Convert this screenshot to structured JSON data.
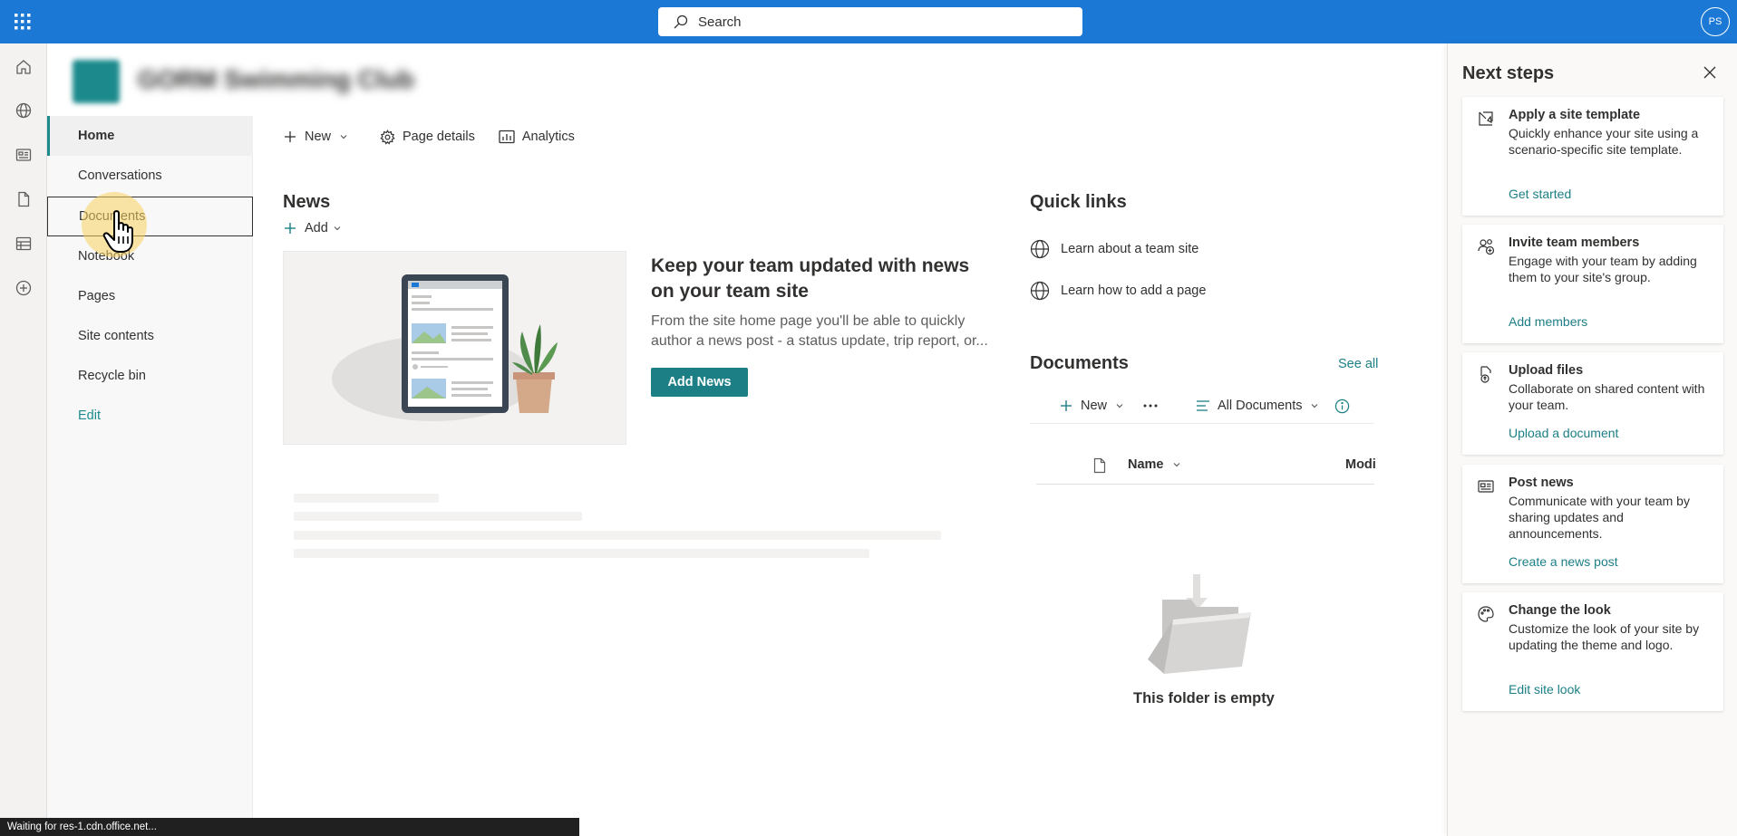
{
  "search": {
    "placeholder": "Search"
  },
  "user": {
    "initials": "PS"
  },
  "site": {
    "title": "GORM Swimming Club"
  },
  "nav": {
    "items": [
      {
        "label": "Home"
      },
      {
        "label": "Conversations"
      },
      {
        "label": "Documents"
      },
      {
        "label": "Notebook"
      },
      {
        "label": "Pages"
      },
      {
        "label": "Site contents"
      },
      {
        "label": "Recycle bin"
      },
      {
        "label": "Edit"
      }
    ]
  },
  "commandbar": {
    "new_label": "New",
    "page_details_label": "Page details",
    "analytics_label": "Analytics"
  },
  "news": {
    "title": "News",
    "add_label": "Add",
    "headline": "Keep your team updated with news on your team site",
    "description": "From the site home page you'll be able to quickly author a news post - a status update, trip report, or...",
    "button_label": "Add News"
  },
  "quicklinks": {
    "title": "Quick links",
    "items": [
      {
        "label": "Learn about a team site"
      },
      {
        "label": "Learn how to add a page"
      }
    ]
  },
  "documents": {
    "title": "Documents",
    "see_all": "See all",
    "new_label": "New",
    "view_label": "All Documents",
    "col_name": "Name",
    "col_modified": "Modi",
    "empty_text": "This folder is empty"
  },
  "next_steps": {
    "title": "Next steps",
    "cards": [
      {
        "title": "Apply a site template",
        "description": "Quickly enhance your site using a scenario-specific site template.",
        "link": "Get started",
        "icon": "template-icon"
      },
      {
        "title": "Invite team members",
        "description": "Engage with your team by adding them to your site's group.",
        "link": "Add members",
        "icon": "add-people-icon"
      },
      {
        "title": "Upload files",
        "description": "Collaborate on shared content with your team.",
        "link": "Upload a document",
        "icon": "upload-file-icon"
      },
      {
        "title": "Post news",
        "description": "Communicate with your team by sharing updates and announcements.",
        "link": "Create a news post",
        "icon": "news-icon"
      },
      {
        "title": "Change the look",
        "description": "Customize the look of your site by updating the theme and logo.",
        "link": "Edit site look",
        "icon": "palette-icon"
      }
    ]
  },
  "statusbar": {
    "text": "Waiting for res-1.cdn.office.net..."
  },
  "colors": {
    "suite_bar": "#1b78d4",
    "theme": "#1c7f86",
    "nav_accent": "#1c8a8c"
  }
}
